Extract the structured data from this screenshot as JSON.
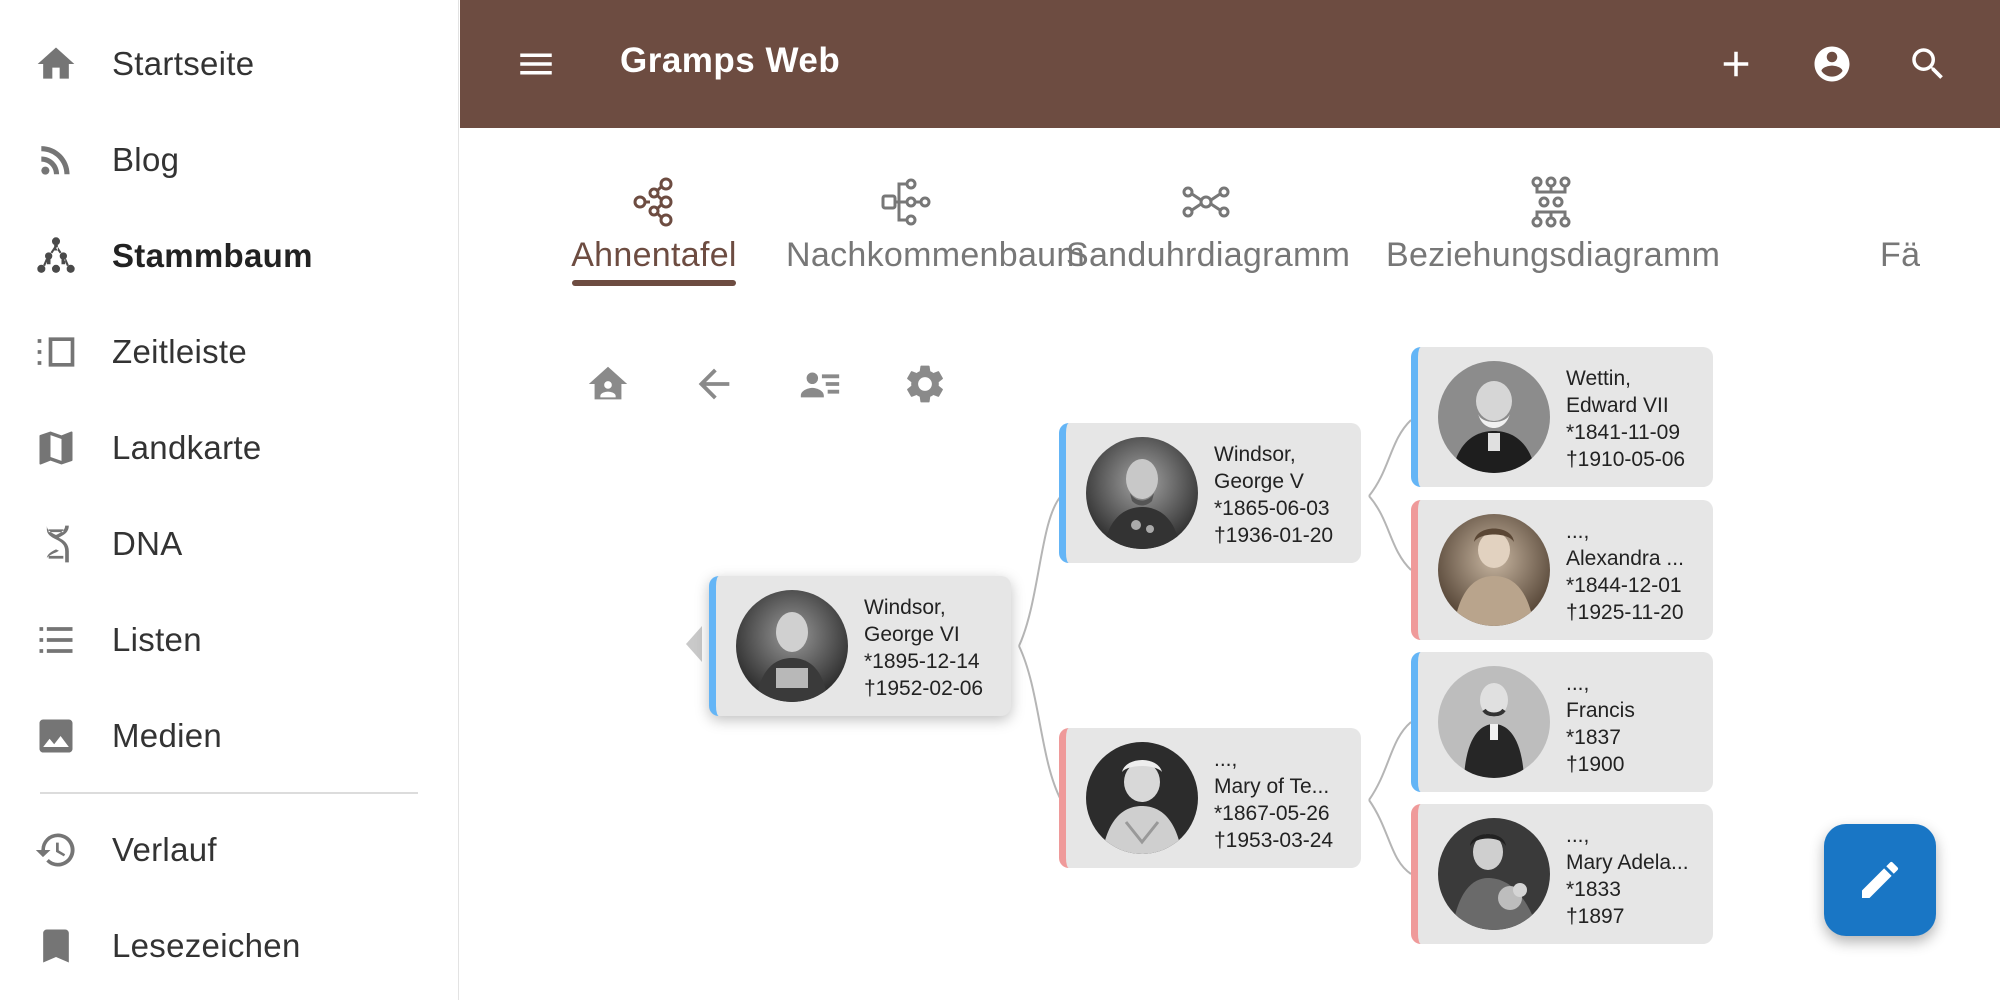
{
  "sidebar": {
    "items": [
      {
        "label": "Startseite",
        "icon": "home-icon"
      },
      {
        "label": "Blog",
        "icon": "rss-feed-icon"
      },
      {
        "label": "Stammbaum",
        "icon": "family-tree-icon",
        "active": true
      },
      {
        "label": "Zeitleiste",
        "icon": "timeline-icon"
      },
      {
        "label": "Landkarte",
        "icon": "map-icon"
      },
      {
        "label": "DNA",
        "icon": "dna-icon"
      },
      {
        "label": "Listen",
        "icon": "list-icon"
      },
      {
        "label": "Medien",
        "icon": "image-icon"
      },
      {
        "label": "Verlauf",
        "icon": "history-icon"
      },
      {
        "label": "Lesezeichen",
        "icon": "bookmark-icon"
      }
    ]
  },
  "appbar": {
    "title": "Gramps Web",
    "color": "#6d4c41"
  },
  "tabs": [
    {
      "label": "Ahnentafel",
      "icon": "pedigree-icon",
      "active": true
    },
    {
      "label": "Nachkommenbaum",
      "icon": "descendant-tree-icon"
    },
    {
      "label": "Sanduhrdiagramm",
      "icon": "hourglass-chart-icon"
    },
    {
      "label": "Beziehungsdiagramm",
      "icon": "relationship-chart-icon"
    },
    {
      "label": "Fä",
      "icon": "fan-chart-icon"
    }
  ],
  "tree": {
    "root": {
      "surname": "Windsor,",
      "given": "George VI",
      "birth": "*1895-12-14",
      "death": "†1952-02-06",
      "sex": "male"
    },
    "father": {
      "surname": "Windsor,",
      "given": "George V",
      "birth": "*1865-06-03",
      "death": "†1936-01-20",
      "sex": "male"
    },
    "mother": {
      "surname": "...,",
      "given": "Mary of Te...",
      "birth": "*1867-05-26",
      "death": "†1953-03-24",
      "sex": "female"
    },
    "paternal_grandfather": {
      "surname": "Wettin,",
      "given": "Edward VII",
      "birth": "*1841-11-09",
      "death": "†1910-05-06",
      "sex": "male"
    },
    "paternal_grandmother": {
      "surname": "...,",
      "given": "Alexandra ...",
      "birth": "*1844-12-01",
      "death": "†1925-11-20",
      "sex": "female"
    },
    "maternal_grandfather": {
      "surname": "...,",
      "given": "Francis",
      "birth": "*1837",
      "death": "†1900",
      "sex": "male"
    },
    "maternal_grandmother": {
      "surname": "...,",
      "given": "Mary Adela...",
      "birth": "*1833",
      "death": "†1897",
      "sex": "female"
    }
  },
  "colors": {
    "male_border": "#64b5f6",
    "female_border": "#ef9a9a",
    "fab": "#1976c5"
  }
}
